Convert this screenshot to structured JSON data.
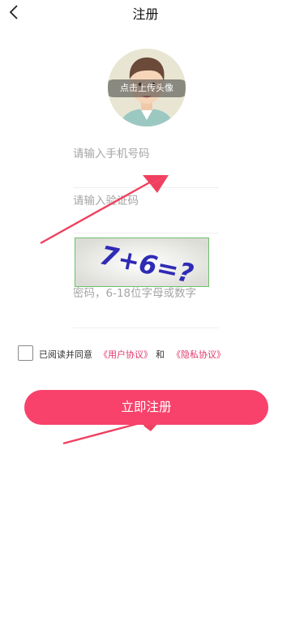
{
  "header": {
    "title": "注册",
    "back_icon": "chevron-left-icon"
  },
  "avatar": {
    "overlay_text": "点击上传头像"
  },
  "form": {
    "phone_placeholder": "请输入手机号码",
    "verify_placeholder": "请输入验证码",
    "captcha_text": "7+6=?",
    "password_placeholder": "密码，6-18位字母或数字"
  },
  "agreement": {
    "text": "已阅读并同意",
    "user_link": "《用户协议》",
    "and": "和",
    "privacy_link": "《隐私协议》"
  },
  "register_button": "立即注册",
  "colors": {
    "accent": "#f8426b",
    "link": "#e2376a",
    "annotation_arrow": "#f0405f"
  }
}
